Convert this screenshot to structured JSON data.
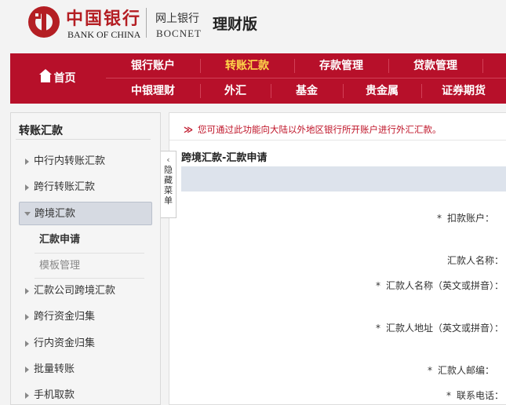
{
  "header": {
    "bank_name_cn": "中国银行",
    "bank_name_en": "BANK OF CHINA",
    "online_cn": "网上银行",
    "online_en": "BOCNET",
    "edition": "理财版"
  },
  "nav": {
    "home": "首页",
    "row1": [
      "银行账户",
      "转账汇款",
      "存款管理",
      "贷款管理"
    ],
    "row2": [
      "中银理财",
      "外汇",
      "基金",
      "贵金属",
      "证券期货"
    ],
    "active": "转账汇款",
    "active_color": "#ffd74a",
    "bg_color": "#b7102a"
  },
  "sidebar": {
    "title": "转账汇款",
    "items": [
      {
        "label": "中行内转账汇款"
      },
      {
        "label": "跨行转账汇款"
      },
      {
        "label": "跨境汇款",
        "expanded": true
      },
      {
        "label": "汇款公司跨境汇款"
      },
      {
        "label": "跨行资金归集"
      },
      {
        "label": "行内资金归集"
      },
      {
        "label": "批量转账"
      },
      {
        "label": "手机取款"
      }
    ],
    "sub_items": [
      {
        "label": "汇款申请",
        "current": true
      },
      {
        "label": "模板管理"
      }
    ]
  },
  "collapse_tab": {
    "chevron": "‹",
    "label_chars": [
      "隐",
      "藏",
      "菜",
      "单"
    ]
  },
  "main": {
    "notice_mark": "≫",
    "notice": "您可通过此功能向大陆以外地区银行所开账户进行外汇汇款。",
    "form_title": "跨境汇款-汇款申请",
    "fields": [
      {
        "required": true,
        "label": "扣款账户："
      },
      {
        "required": false,
        "label": "汇款人名称："
      },
      {
        "required": true,
        "label": "汇款人名称（英文或拼音）："
      },
      {
        "required": true,
        "label": "汇款人地址（英文或拼音）："
      },
      {
        "required": true,
        "label": "汇款人邮编："
      },
      {
        "required": true,
        "label": "联系电话："
      }
    ]
  }
}
